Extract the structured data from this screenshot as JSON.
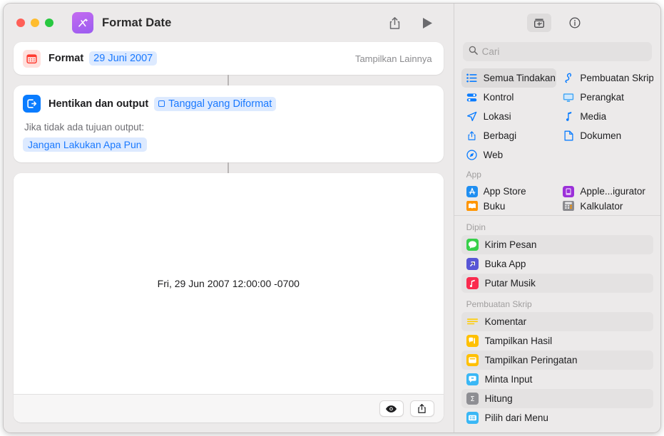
{
  "window": {
    "title": "Format Date",
    "app_icon": "shortcuts-icon",
    "traffic_lights": [
      "close",
      "minimize",
      "zoom"
    ]
  },
  "toolbar": {
    "share_label": "share-icon",
    "run_label": "play-icon"
  },
  "workflow": {
    "actions": [
      {
        "icon": "calendar-icon",
        "label": "Format",
        "token": "29 Juni 2007",
        "show_more": "Tampilkan Lainnya"
      },
      {
        "icon": "stop-output-icon",
        "label": "Hentikan dan output",
        "token": "Tanggal yang Diformat",
        "sub_label": "Jika tidak ada tujuan output:",
        "sub_token": "Jangan Lakukan Apa Pun"
      }
    ],
    "preview": {
      "result_text": "Fri, 29 Jun 2007 12:00:00 -0700",
      "quicklook_icon": "eye-icon",
      "share_icon": "share-icon"
    }
  },
  "sidebar": {
    "toolbar": [
      {
        "name": "action-library-icon",
        "selected": true
      },
      {
        "name": "info-icon",
        "selected": false
      }
    ],
    "search": {
      "placeholder": "Cari",
      "value": "",
      "icon": "search-icon"
    },
    "categories": [
      {
        "label": "Semua Tindakan",
        "icon": "list-icon",
        "selected": true
      },
      {
        "label": "Pembuatan Skrip",
        "icon": "script-icon",
        "selected": false
      },
      {
        "label": "Kontrol",
        "icon": "control-icon",
        "selected": false
      },
      {
        "label": "Perangkat",
        "icon": "device-icon",
        "selected": false
      },
      {
        "label": "Lokasi",
        "icon": "location-icon",
        "selected": false
      },
      {
        "label": "Media",
        "icon": "music-note-icon",
        "selected": false
      },
      {
        "label": "Berbagi",
        "icon": "share-icon",
        "selected": false
      },
      {
        "label": "Dokumen",
        "icon": "document-icon",
        "selected": false
      },
      {
        "label": "Web",
        "icon": "compass-icon",
        "selected": false
      }
    ],
    "app_group": {
      "header": "App",
      "items": [
        {
          "label": "App Store",
          "icon": "app-store-icon"
        },
        {
          "label": "Apple...igurator",
          "icon": "apple-configurator-icon"
        },
        {
          "label": "Buku",
          "icon": "books-icon"
        },
        {
          "label": "Kalkulator",
          "icon": "calculator-icon"
        }
      ]
    },
    "sections": [
      {
        "header": "Dipin",
        "items": [
          {
            "label": "Kirim Pesan",
            "icon": "messages-icon",
            "color": "#37d04a"
          },
          {
            "label": "Buka App",
            "icon": "open-app-icon",
            "color": "#5856d6"
          },
          {
            "label": "Putar Musik",
            "icon": "music-icon",
            "color": "#fa2b4e"
          }
        ]
      },
      {
        "header": "Pembuatan Skrip",
        "items": [
          {
            "label": "Komentar",
            "icon": "comment-icon",
            "color": "#ffcc00"
          },
          {
            "label": "Tampilkan Hasil",
            "icon": "show-result-icon",
            "color": "#ffc000"
          },
          {
            "label": "Tampilkan Peringatan",
            "icon": "show-alert-icon",
            "color": "#ffc000"
          },
          {
            "label": "Minta Input",
            "icon": "ask-input-icon",
            "color": "#3ab7f5"
          },
          {
            "label": "Hitung",
            "icon": "calculate-icon",
            "color": "#8e8e93"
          },
          {
            "label": "Pilih dari Menu",
            "icon": "choose-menu-icon",
            "color": "#3ab7f5"
          }
        ]
      }
    ]
  },
  "colors": {
    "accent_blue": "#0a7cff",
    "token_blue_bg": "#ddeaff",
    "token_blue_text": "#1a79ff",
    "window_bg": "#eceaea",
    "card_bg": "#ffffff"
  }
}
